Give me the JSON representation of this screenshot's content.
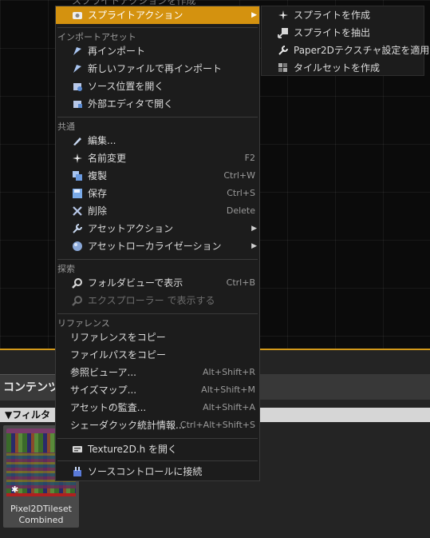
{
  "top_cut_item": "スプライトアクションを作成",
  "menu": {
    "highlighted": {
      "label": "スプライトアクション",
      "icon": "sprite-action-icon"
    },
    "sections": [
      {
        "title": "インポートアセット",
        "items": [
          {
            "label": "再インポート",
            "icon": "reimport-icon",
            "shortcut": ""
          },
          {
            "label": "新しいファイルで再インポート",
            "icon": "reimport-new-file-icon",
            "shortcut": ""
          },
          {
            "label": "ソース位置を開く",
            "icon": "open-source-location-icon",
            "shortcut": ""
          },
          {
            "label": "外部エディタで開く",
            "icon": "external-editor-icon",
            "shortcut": ""
          }
        ]
      },
      {
        "title": "共通",
        "items": [
          {
            "label": "編集...",
            "icon": "edit-icon",
            "shortcut": ""
          },
          {
            "label": "名前変更",
            "icon": "rename-icon",
            "shortcut": "F2"
          },
          {
            "label": "複製",
            "icon": "duplicate-icon",
            "shortcut": "Ctrl+W"
          },
          {
            "label": "保存",
            "icon": "save-icon",
            "shortcut": "Ctrl+S"
          },
          {
            "label": "削除",
            "icon": "delete-icon",
            "shortcut": "Delete"
          },
          {
            "label": "アセットアクション",
            "icon": "wrench-icon",
            "shortcut": ""
          },
          {
            "label": "アセットローカライゼーション",
            "icon": "globe-icon",
            "shortcut": ""
          }
        ]
      },
      {
        "title": "探索",
        "items": [
          {
            "label": "フォルダビューで表示",
            "icon": "magnifier-icon",
            "shortcut": "Ctrl+B"
          },
          {
            "label": "エクスプローラー で表示する",
            "icon": "magnifier-icon",
            "shortcut": ""
          }
        ]
      },
      {
        "title": "リファレンス",
        "items": [
          {
            "label": "リファレンスをコピー",
            "shortcut": ""
          },
          {
            "label": "ファイルパスをコピー",
            "shortcut": ""
          },
          {
            "label": "参照ビューア...",
            "shortcut": "Alt+Shift+R"
          },
          {
            "label": "サイズマップ...",
            "shortcut": "Alt+Shift+M"
          },
          {
            "label": "アセットの監査...",
            "shortcut": "Alt+Shift+A"
          },
          {
            "label": "シェーダクック統計情報...",
            "shortcut": "Ctrl+Alt+Shift+S"
          }
        ]
      }
    ],
    "open_header": {
      "label": "Texture2D.h を開く",
      "icon": "code-file-icon"
    },
    "source_control": {
      "label": "ソースコントロールに接続",
      "icon": "source-control-icon"
    }
  },
  "submenu": {
    "items": [
      {
        "label": "スプライトを作成",
        "icon": "create-sprite-icon"
      },
      {
        "label": "スプライトを抽出",
        "icon": "extract-sprite-icon"
      },
      {
        "label": "Paper2Dテクスチャ設定を適用",
        "icon": "apply-settings-icon"
      },
      {
        "label": "タイルセットを作成",
        "icon": "tileset-icon"
      }
    ]
  },
  "content_browser": {
    "tab_label": "コンテンツ",
    "filter_label": "▼フィルタ",
    "asset": {
      "name_line1": "Pixel2DTileset",
      "name_line2": "Combined",
      "badge": "✱"
    }
  },
  "colors": {
    "highlight": "#d4920f",
    "accent_border": "#d49a1a"
  }
}
